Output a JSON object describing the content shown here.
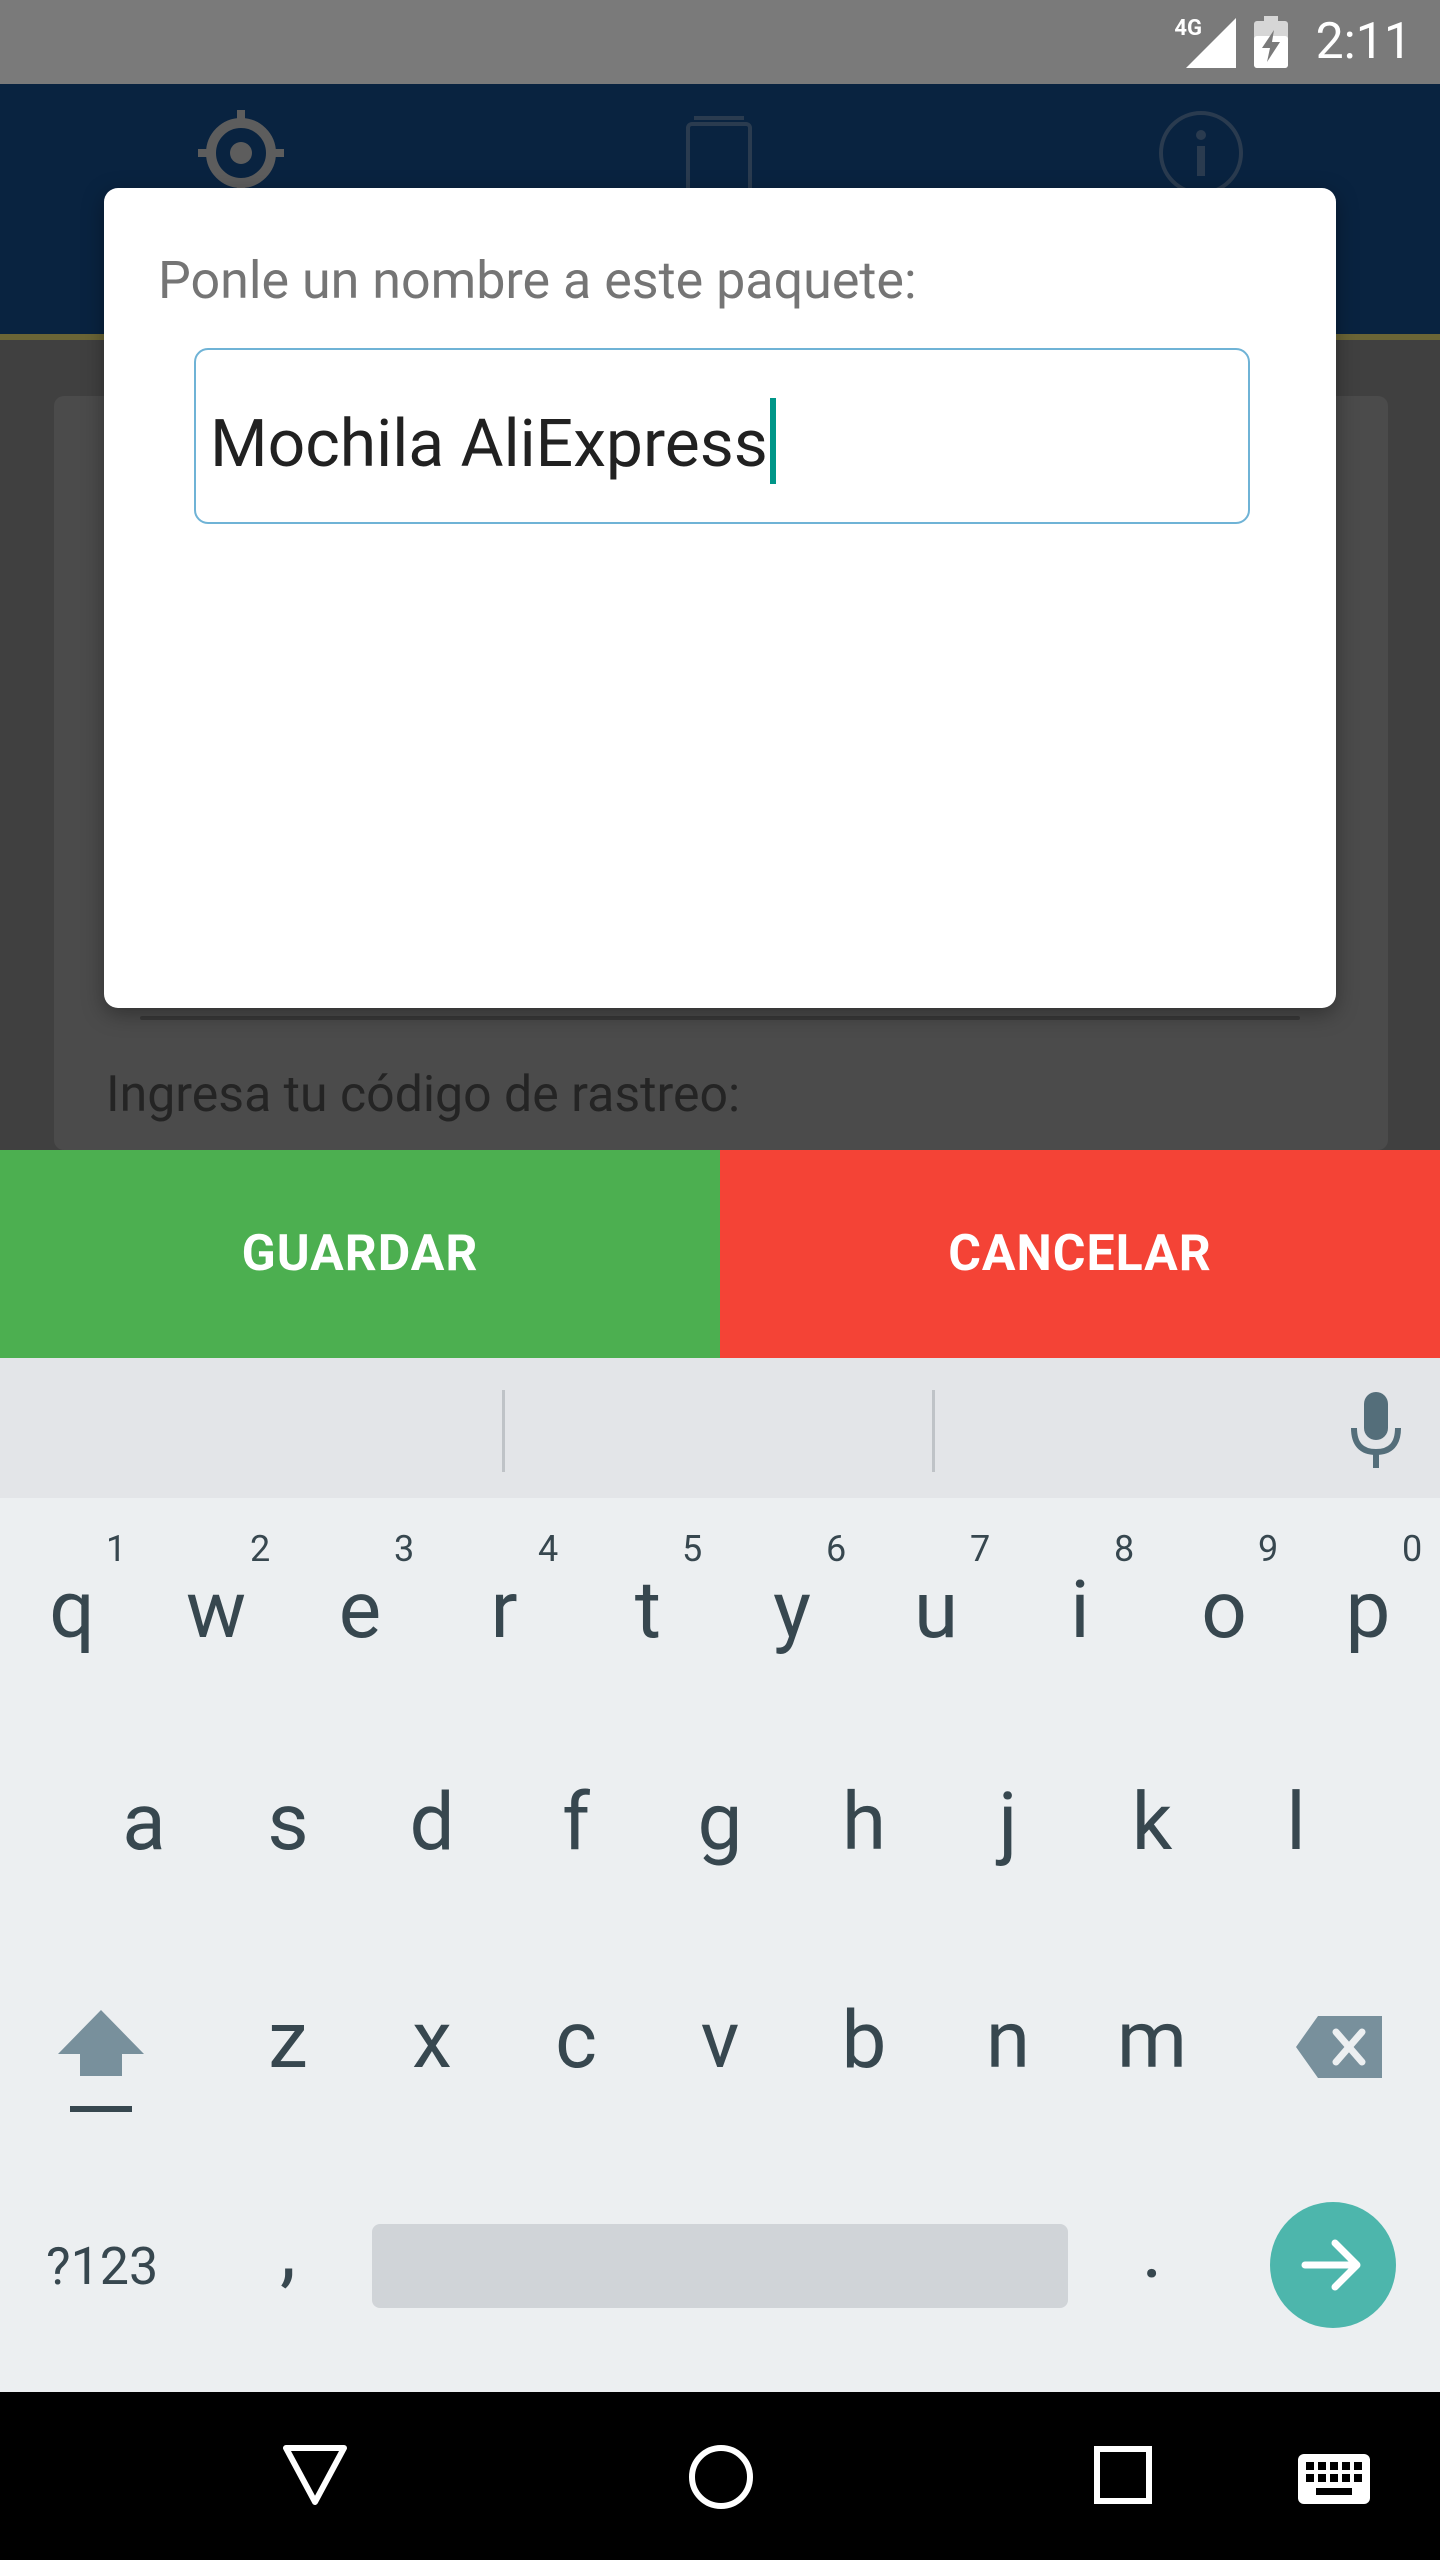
{
  "status_bar": {
    "network": "4G",
    "time": "2:11"
  },
  "app": {
    "tracking_label": "Ingresa tu código de rastreo:"
  },
  "dialog": {
    "title": "Ponle un nombre a este paquete:",
    "input_value": "Mochila AliExpress"
  },
  "actions": {
    "save_label": "GUARDAR",
    "cancel_label": "CANCELAR"
  },
  "keyboard": {
    "row1": [
      {
        "key": "q",
        "hint": "1"
      },
      {
        "key": "w",
        "hint": "2"
      },
      {
        "key": "e",
        "hint": "3"
      },
      {
        "key": "r",
        "hint": "4"
      },
      {
        "key": "t",
        "hint": "5"
      },
      {
        "key": "y",
        "hint": "6"
      },
      {
        "key": "u",
        "hint": "7"
      },
      {
        "key": "i",
        "hint": "8"
      },
      {
        "key": "o",
        "hint": "9"
      },
      {
        "key": "p",
        "hint": "0"
      }
    ],
    "row2": [
      "a",
      "s",
      "d",
      "f",
      "g",
      "h",
      "j",
      "k",
      "l"
    ],
    "row3": [
      "z",
      "x",
      "c",
      "v",
      "b",
      "n",
      "m"
    ],
    "symbols_label": "?123",
    "comma": ",",
    "period": "."
  },
  "colors": {
    "save": "#4caf50",
    "cancel": "#f44336",
    "appbar": "#092340",
    "accent": "#4db6ac"
  },
  "icons": {
    "tabs": [
      "crosshair-icon",
      "list-icon",
      "info-icon"
    ],
    "status": [
      "signal-icon",
      "battery-charging-icon"
    ],
    "nav": [
      "back-icon",
      "home-icon",
      "recents-icon",
      "keyboard-icon"
    ]
  }
}
